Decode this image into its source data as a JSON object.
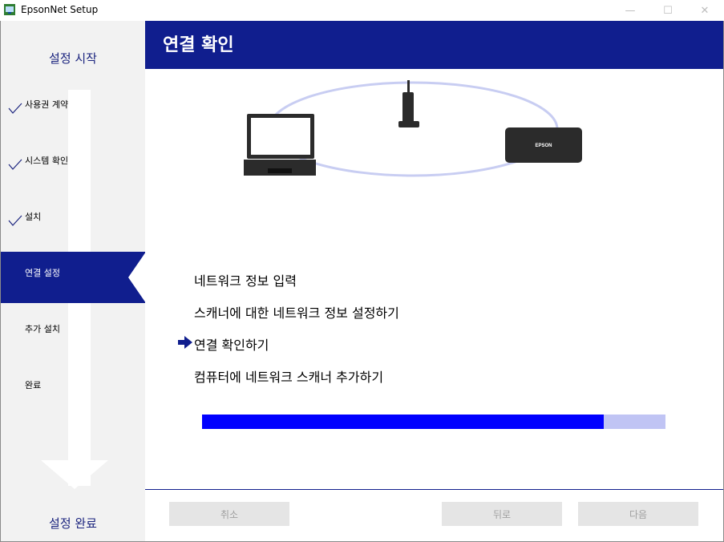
{
  "window": {
    "title": "EpsonNet Setup",
    "minimize": "—",
    "maximize": "☐",
    "close": "✕"
  },
  "sidebar": {
    "start_label": "설정 시작",
    "end_label": "설정 완료",
    "steps": [
      {
        "label": "사용권 계약",
        "done": true
      },
      {
        "label": "시스템 확인",
        "done": true
      },
      {
        "label": "설치",
        "done": true
      },
      {
        "label": "연결 설정",
        "active": true
      },
      {
        "label": "추가 설치",
        "done": false
      },
      {
        "label": "완료",
        "done": false
      }
    ]
  },
  "header": {
    "title": "연결 확인"
  },
  "diagram": {
    "printer_brand": "EPSON",
    "icons": [
      "laptop-icon",
      "router-icon",
      "scanner-icon"
    ]
  },
  "flow": {
    "current_index": 2,
    "items": [
      "네트워크 정보 입력",
      "스캐너에 대한 네트워크 정보 설정하기",
      "연결 확인하기",
      "컴퓨터에 네트워크 스캐너 추가하기"
    ]
  },
  "progress": {
    "fraction": 0.867,
    "fill_color": "#0000ff",
    "track_color": "#c0c4f4"
  },
  "buttons": {
    "cancel": "취소",
    "back": "뒤로",
    "next": "다음"
  },
  "colors": {
    "brand_navy": "#101e8e",
    "sidebar_bg": "#f2f2f2"
  }
}
